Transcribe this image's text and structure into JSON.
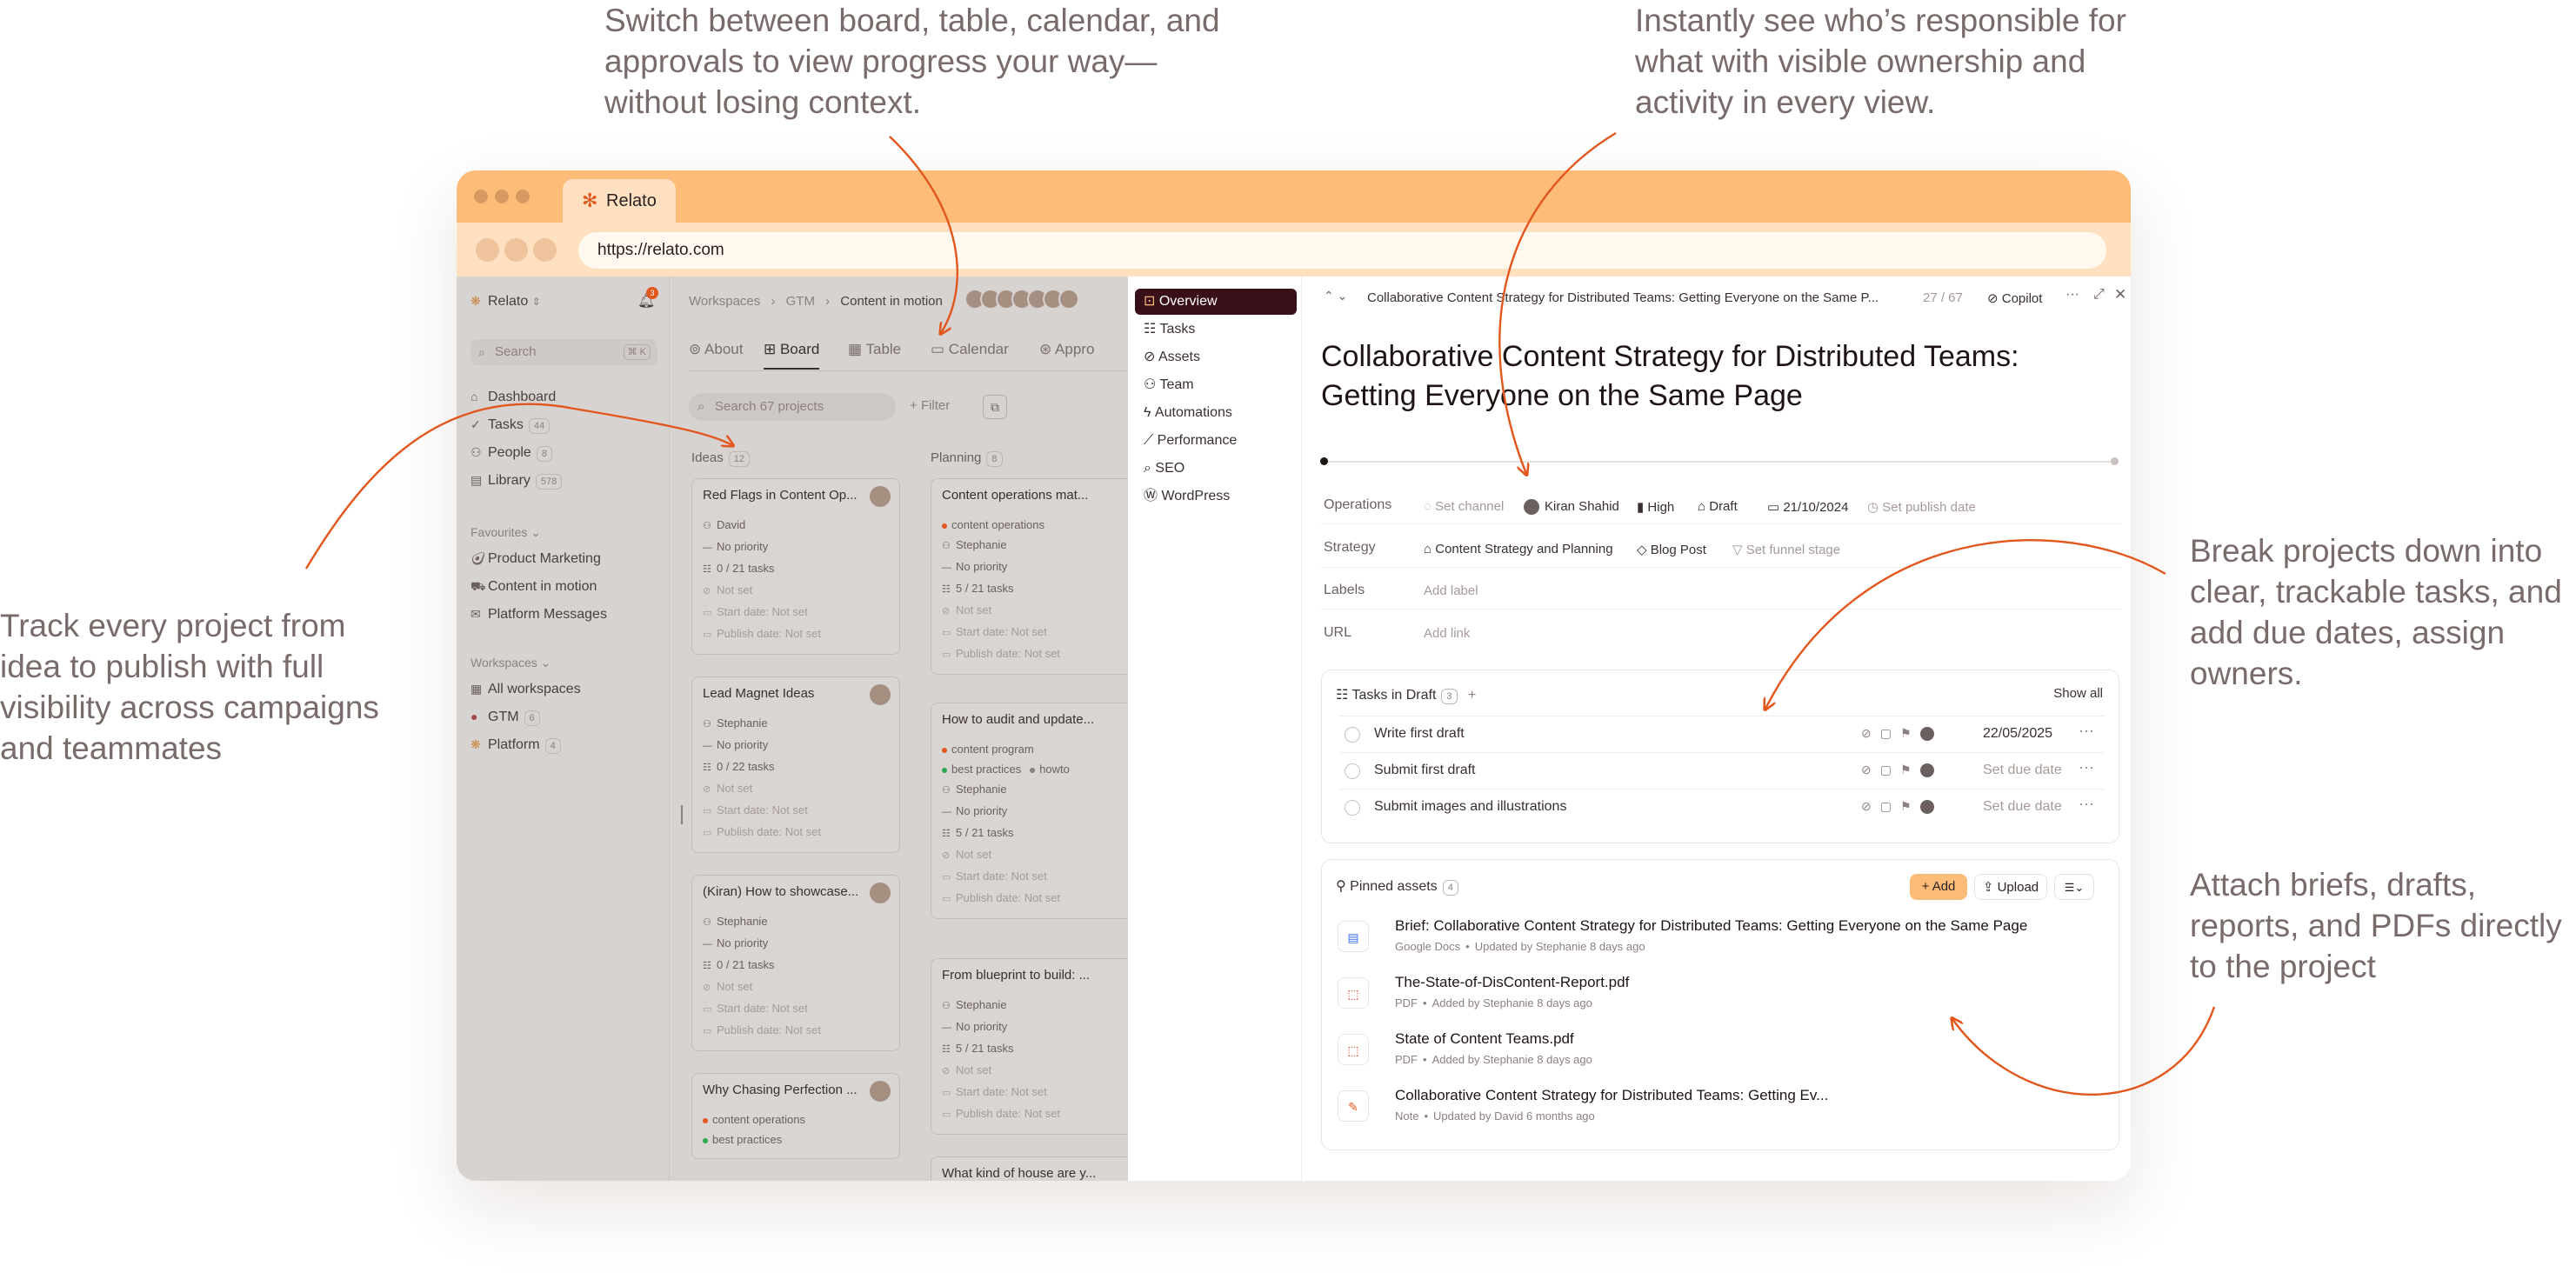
{
  "annotations": {
    "a1": [
      "Switch between board, table, calendar, and",
      "approvals to view progress your way—",
      "without losing context."
    ],
    "a2": [
      "Instantly see who’s responsible for",
      "what with visible ownership and",
      "activity in every view."
    ],
    "a3": [
      "Track every project from",
      "idea to publish with full",
      "visibility across campaigns",
      "and teammates"
    ],
    "a4": [
      "Break projects down into",
      "clear, trackable tasks, and",
      "add due dates, assign",
      "owners."
    ],
    "a5": [
      "Attach briefs, drafts,",
      "reports, and PDFs directly",
      "to the project"
    ]
  },
  "browser": {
    "tab_title": "Relato",
    "url": "https://relato.com"
  },
  "sidebar": {
    "workspace": "Relato",
    "notif_count": "3",
    "search_placeholder": "Search",
    "search_kbd": "⌘ K",
    "nav": [
      {
        "label": "Dashboard",
        "count": ""
      },
      {
        "label": "Tasks",
        "count": "44"
      },
      {
        "label": "People",
        "count": "8"
      },
      {
        "label": "Library",
        "count": "578"
      }
    ],
    "favourites_label": "Favourites",
    "favourites": [
      "Product Marketing",
      "Content in motion",
      "Platform Messages"
    ],
    "workspaces_label": "Workspaces",
    "workspaces": [
      {
        "label": "All workspaces",
        "count": ""
      },
      {
        "label": "GTM",
        "count": "6"
      },
      {
        "label": "Platform",
        "count": "4"
      }
    ]
  },
  "main": {
    "breadcrumbs": [
      "Workspaces",
      "GTM",
      "Content in motion"
    ],
    "tabs": [
      "About",
      "Board",
      "Table",
      "Calendar",
      "Appro"
    ],
    "search_placeholder": "Search 67 projects",
    "filter_label": "Filter",
    "columns": [
      {
        "title": "Ideas",
        "count": "12"
      },
      {
        "title": "Planning",
        "count": "8"
      }
    ],
    "cards_col1": [
      {
        "title": "Red Flags in Content Op...",
        "lines": [
          "David",
          "No priority",
          "0 / 21 tasks",
          "Not set",
          "Start date: Not set",
          "Publish date: Not set"
        ]
      },
      {
        "title": "Lead Magnet Ideas",
        "lines": [
          "Stephanie",
          "No priority",
          "0 / 22 tasks",
          "Not set",
          "Start date: Not set",
          "Publish date: Not set"
        ]
      },
      {
        "title": "(Kiran) How to showcase...",
        "lines": [
          "Stephanie",
          "No priority",
          "0 / 21 tasks",
          "Not set",
          "Start date: Not set",
          "Publish date: Not set"
        ]
      },
      {
        "title": "Why Chasing Perfection ...",
        "tags": [
          "content operations",
          "best practices"
        ]
      }
    ],
    "cards_col2": [
      {
        "title": "Content operations mat...",
        "tags": [
          "content operations"
        ],
        "lines": [
          "Stephanie",
          "No priority",
          "5 / 21 tasks",
          "Not set",
          "Start date: Not set",
          "Publish date: Not set"
        ]
      },
      {
        "title": "How to audit and update...",
        "tags": [
          "content program",
          "best practices",
          "howto"
        ],
        "lines": [
          "Stephanie",
          "No priority",
          "5 / 21 tasks",
          "Not set",
          "Start date: Not set",
          "Publish date: Not set"
        ]
      },
      {
        "title": "From blueprint to build: ...",
        "lines": [
          "Stephanie",
          "No priority",
          "5 / 21 tasks",
          "Not set",
          "Start date: Not set",
          "Publish date: Not set"
        ]
      },
      {
        "title": "What kind of house are y..."
      }
    ]
  },
  "detail_nav": [
    "Overview",
    "Tasks",
    "Assets",
    "Team",
    "Automations",
    "Performance",
    "SEO",
    "WordPress"
  ],
  "detail": {
    "header_title": "Collaborative Content Strategy for Distributed Teams: Getting Everyone on the Same P...",
    "counter": "27 / 67",
    "copilot": "Copilot",
    "title": "Collaborative Content Strategy for Distributed Teams: Getting Everyone on the Same Page",
    "props": {
      "operations_label": "Operations",
      "set_channel": "Set channel",
      "owner": "Kiran Shahid",
      "priority": "High",
      "status": "Draft",
      "date": "21/10/2024",
      "set_publish": "Set publish date",
      "strategy_label": "Strategy",
      "strategy_value": "Content Strategy and Planning",
      "type": "Blog Post",
      "funnel": "Set funnel stage",
      "labels_label": "Labels",
      "add_label": "Add label",
      "url_label": "URL",
      "add_link": "Add link"
    },
    "tasks": {
      "title": "Tasks in Draft",
      "count": "3",
      "show_all": "Show all",
      "items": [
        {
          "name": "Write first draft",
          "due": "22/05/2025"
        },
        {
          "name": "Submit first draft",
          "due": "Set due date"
        },
        {
          "name": "Submit images and illustrations",
          "due": "Set due date"
        }
      ]
    },
    "assets": {
      "title": "Pinned assets",
      "count": "4",
      "add": "Add",
      "upload": "Upload",
      "items": [
        {
          "name": "Brief: Collaborative Content Strategy for Distributed Teams: Getting Everyone on the Same Page",
          "kind": "Google Docs",
          "meta": "Updated by Stephanie 8 days ago",
          "color": "#3b6fe0"
        },
        {
          "name": "The-State-of-DisContent-Report.pdf",
          "kind": "PDF",
          "meta": "Added by Stephanie 8 days ago",
          "color": "#e0352b"
        },
        {
          "name": "State of Content Teams.pdf",
          "kind": "PDF",
          "meta": "Added by Stephanie 8 days ago",
          "color": "#e0352b"
        },
        {
          "name": "Collaborative Content Strategy for Distributed Teams: Getting Ev...",
          "kind": "Note",
          "meta": "Updated by David 6 months ago",
          "color": "#e2571e"
        }
      ]
    }
  },
  "colors": {
    "accent": "#e2571e",
    "tabbar": "#fdbd79",
    "urlbar": "#ffe1c1",
    "active_nav": "#3a1018"
  }
}
